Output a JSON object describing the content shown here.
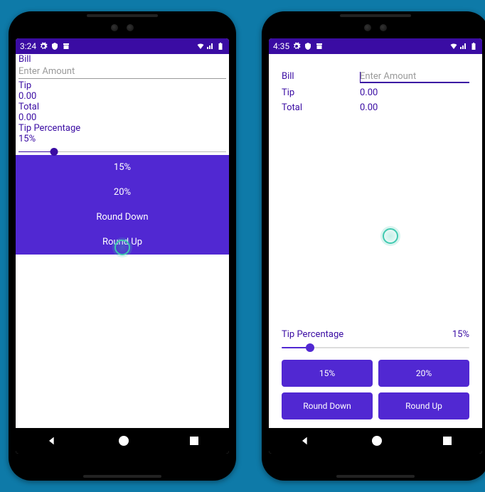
{
  "phone1": {
    "status": {
      "time": "3:24"
    },
    "labels": {
      "bill": "Bill",
      "tip": "Tip",
      "total": "Total",
      "tip_pct": "Tip Percentage"
    },
    "amount_placeholder": "Enter Amount",
    "tip_value": "0.00",
    "total_value": "0.00",
    "tip_pct_value": "15%",
    "buttons": {
      "b15": "15%",
      "b20": "20%",
      "round_down": "Round Down",
      "round_up": "Round Up"
    }
  },
  "phone2": {
    "status": {
      "time": "4:35"
    },
    "labels": {
      "bill": "Bill",
      "tip": "Tip",
      "total": "Total",
      "tip_pct": "Tip Percentage"
    },
    "amount_placeholder": "Enter Amount",
    "tip_value": "0.00",
    "total_value": "0.00",
    "tip_pct_value": "15%",
    "buttons": {
      "b15": "15%",
      "b20": "20%",
      "round_down": "Round Down",
      "round_up": "Round Up"
    }
  }
}
